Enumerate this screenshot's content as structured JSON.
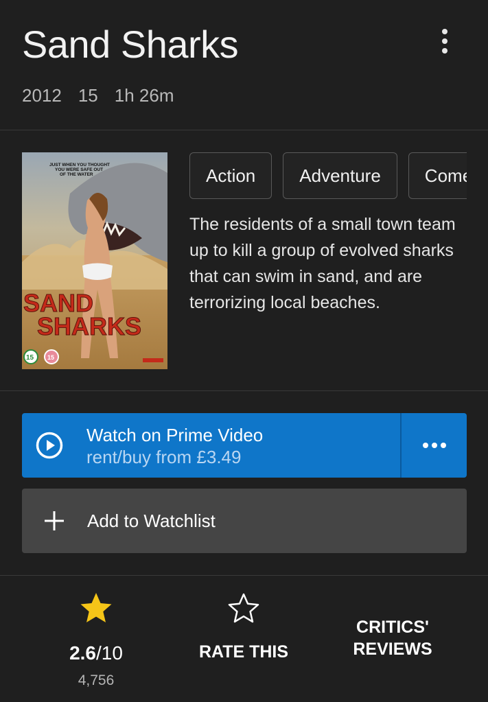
{
  "movie": {
    "title": "Sand Sharks",
    "year": "2012",
    "certificate": "15",
    "runtime": "1h 26m",
    "genres": [
      "Action",
      "Adventure",
      "Comedy"
    ],
    "plot": "The residents of a small town team up to kill a group of evolved sharks that can swim in sand, and are terrorizing local beaches.",
    "poster": {
      "tagline": "JUST WHEN YOU THOUGHT YOU WERE SAFE OUT OF THE WATER",
      "title_line1": "SAND",
      "title_line2": "SHARKS",
      "rating_badge": "15"
    }
  },
  "watch": {
    "title": "Watch on Prime Video",
    "subtitle": "rent/buy from £3.49",
    "icon": "play-circle-icon",
    "more_icon": "more-horizontal-icon",
    "color": "#0f76c9"
  },
  "watchlist": {
    "label": "Add to Watchlist",
    "icon": "plus-icon"
  },
  "ratings": {
    "score": "2.6",
    "out_of": "/10",
    "votes": "4,756",
    "rate_label": "RATE THIS",
    "critics_label_line1": "CRITICS'",
    "critics_label_line2": "REVIEWS",
    "star_color": "#f5c518"
  },
  "header": {
    "menu_icon": "more-vertical-icon"
  }
}
